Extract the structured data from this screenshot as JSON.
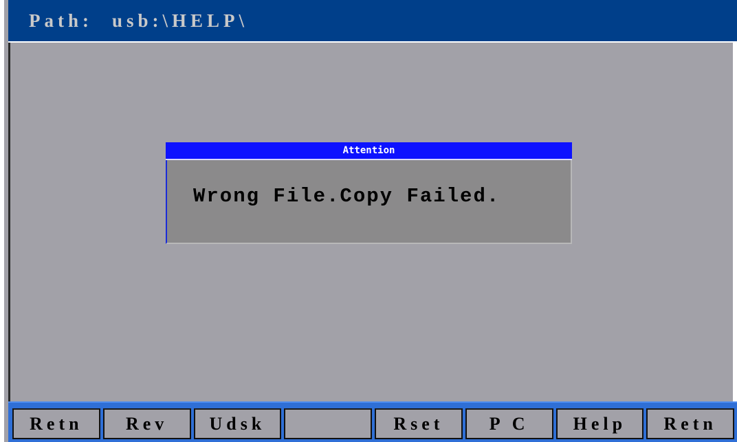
{
  "header": {
    "path_label": "Path:",
    "path_value": "usb:\\HELP\\"
  },
  "dialog": {
    "title": "Attention",
    "message": "Wrong File.Copy Failed."
  },
  "softkeys": [
    {
      "label": "Retn"
    },
    {
      "label": "Rev"
    },
    {
      "label": "Udsk"
    },
    {
      "label": ""
    },
    {
      "label": "Rset"
    },
    {
      "label": "P C"
    },
    {
      "label": "Help"
    },
    {
      "label": "Retn"
    }
  ],
  "colors": {
    "header_bg": "#003f8a",
    "screen_bg": "#a2a1a8",
    "dialog_title_bg": "#0d12ff",
    "dialog_bg": "#8b8a8b",
    "softkey_bar_bg": "#2f6fd6"
  }
}
